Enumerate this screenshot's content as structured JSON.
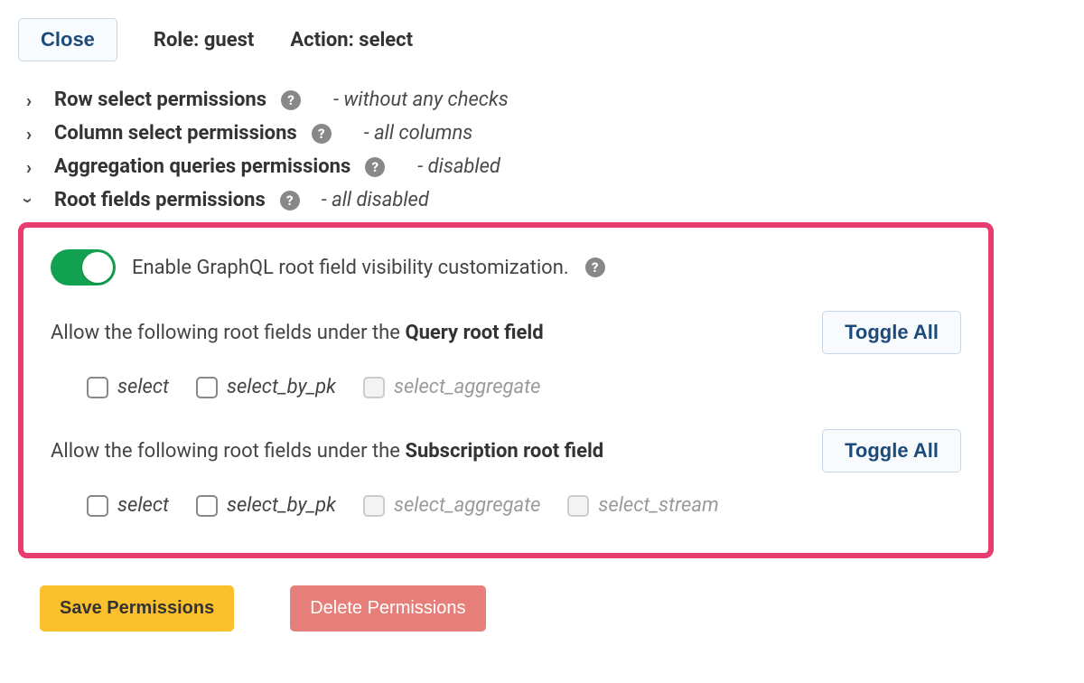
{
  "header": {
    "close_label": "Close",
    "role_prefix": "Role:",
    "role_value": "guest",
    "action_prefix": "Action:",
    "action_value": "select"
  },
  "sections": {
    "row": {
      "title": "Row select permissions",
      "status": "without any checks"
    },
    "column": {
      "title": "Column select permissions",
      "status": "all columns"
    },
    "aggregation": {
      "title": "Aggregation queries permissions",
      "status": "disabled"
    },
    "root": {
      "title": "Root fields permissions",
      "status": "all disabled"
    }
  },
  "root_panel": {
    "toggle_label": "Enable GraphQL root field visibility customization.",
    "query": {
      "allow_prefix": "Allow the following root fields under the ",
      "allow_bold": "Query root field",
      "toggle_all_label": "Toggle All",
      "options": {
        "select": "select",
        "select_by_pk": "select_by_pk",
        "select_aggregate": "select_aggregate"
      }
    },
    "subscription": {
      "allow_prefix": "Allow the following root fields under the ",
      "allow_bold": "Subscription root field",
      "toggle_all_label": "Toggle All",
      "options": {
        "select": "select",
        "select_by_pk": "select_by_pk",
        "select_aggregate": "select_aggregate",
        "select_stream": "select_stream"
      }
    }
  },
  "footer": {
    "save_label": "Save Permissions",
    "delete_label": "Delete Permissions"
  }
}
